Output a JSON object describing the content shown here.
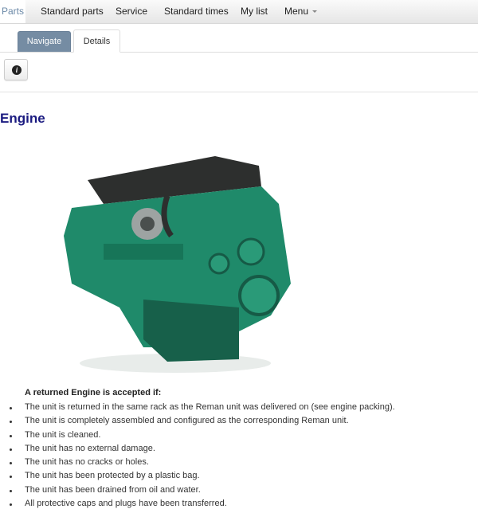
{
  "navbar": {
    "items": [
      {
        "label": "Parts",
        "active": true
      },
      {
        "label": "Standard parts"
      },
      {
        "label": "Service"
      },
      {
        "label": "Standard times"
      },
      {
        "label": "My list"
      },
      {
        "label": "Menu",
        "dropdown": true
      }
    ]
  },
  "tabs": [
    {
      "label": "Navigate",
      "style": "filled"
    },
    {
      "label": "Details",
      "active": true
    }
  ],
  "toolbar": {
    "info_icon": "info-circle-icon"
  },
  "content": {
    "title": "Engine",
    "image": {
      "subject": "green-engine-photo"
    },
    "accept_heading": "A returned Engine is accepted if:",
    "conditions": [
      "The unit is returned in the same rack as the Reman unit was delivered on (see engine packing).",
      "The unit is completely assembled and configured as the corresponding Reman unit.",
      "The unit is cleaned.",
      "The unit has no external damage.",
      "The unit has no cracks or holes.",
      "The unit has been protected by a plastic bag.",
      "The unit has been drained from oil and water.",
      "All protective caps and plugs have been transferred."
    ]
  },
  "colors": {
    "title": "#1a1a80",
    "tab_active_bg": "#758ca3",
    "nav_active_text": "#6c8aa8",
    "engine_green": "#1f8a6a"
  }
}
